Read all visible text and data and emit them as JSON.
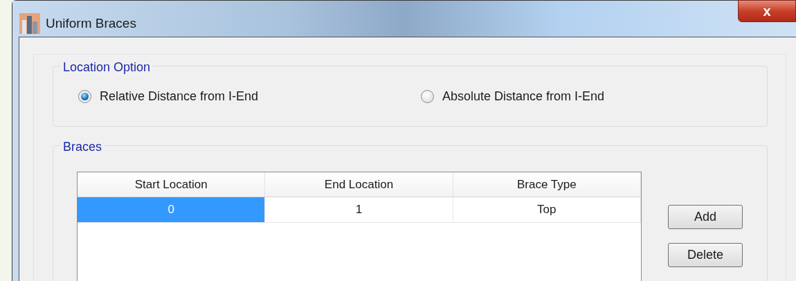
{
  "window": {
    "title": "Uniform Braces",
    "close": "x"
  },
  "location_option": {
    "title": "Location Option",
    "options": [
      {
        "label": "Relative Distance from I-End",
        "selected": true
      },
      {
        "label": "Absolute Distance from I-End",
        "selected": false
      }
    ]
  },
  "braces": {
    "title": "Braces",
    "table": {
      "columns": [
        "Start Location",
        "End Location",
        "Brace Type"
      ],
      "rows": [
        {
          "cells": [
            {
              "text": "0",
              "selected": true
            },
            {
              "text": "1",
              "selected": false
            },
            {
              "text": "Top",
              "selected": false
            }
          ]
        }
      ]
    },
    "buttons": [
      "Add",
      "Delete"
    ]
  }
}
